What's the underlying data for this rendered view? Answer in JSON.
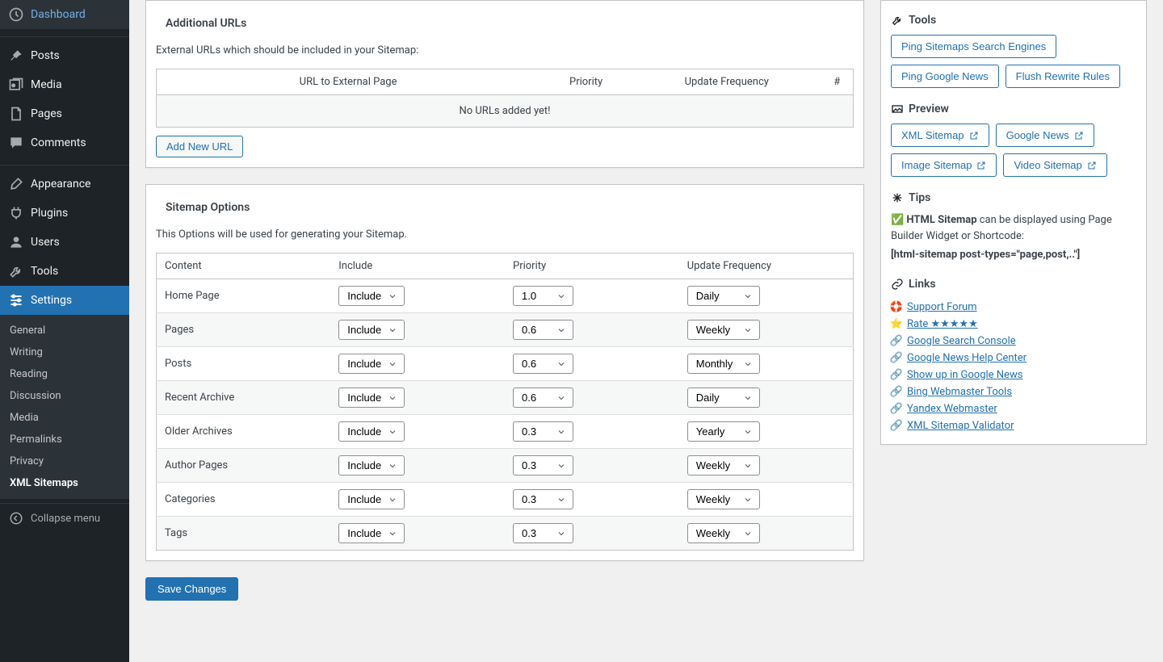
{
  "sidebar": {
    "dashboard": "Dashboard",
    "posts": "Posts",
    "media": "Media",
    "pages": "Pages",
    "comments": "Comments",
    "appearance": "Appearance",
    "plugins": "Plugins",
    "users": "Users",
    "tools": "Tools",
    "settings": "Settings",
    "collapse": "Collapse menu",
    "submenu": {
      "general": "General",
      "writing": "Writing",
      "reading": "Reading",
      "discussion": "Discussion",
      "media": "Media",
      "permalinks": "Permalinks",
      "privacy": "Privacy",
      "xml_sitemaps": "XML Sitemaps"
    }
  },
  "additional_urls": {
    "title": "Additional URLs",
    "description": "External URLs which should be included in your Sitemap:",
    "headers": {
      "url": "URL to External Page",
      "priority": "Priority",
      "freq": "Update Frequency",
      "hash": "#"
    },
    "empty": "No URLs added yet!",
    "add_button": "Add New URL"
  },
  "options": {
    "title": "Sitemap Options",
    "description": "This Options will be used for generating your Sitemap.",
    "headers": {
      "content": "Content",
      "include": "Include",
      "priority": "Priority",
      "freq": "Update Frequency"
    },
    "rows": [
      {
        "content": "Home Page",
        "include": "Include",
        "priority": "1.0",
        "freq": "Daily"
      },
      {
        "content": "Pages",
        "include": "Include",
        "priority": "0.6",
        "freq": "Weekly"
      },
      {
        "content": "Posts",
        "include": "Include",
        "priority": "0.6",
        "freq": "Monthly"
      },
      {
        "content": "Recent Archive",
        "include": "Include",
        "priority": "0.6",
        "freq": "Daily"
      },
      {
        "content": "Older Archives",
        "include": "Include",
        "priority": "0.3",
        "freq": "Yearly"
      },
      {
        "content": "Author Pages",
        "include": "Include",
        "priority": "0.3",
        "freq": "Weekly"
      },
      {
        "content": "Categories",
        "include": "Include",
        "priority": "0.3",
        "freq": "Weekly"
      },
      {
        "content": "Tags",
        "include": "Include",
        "priority": "0.3",
        "freq": "Weekly"
      }
    ]
  },
  "save_button": "Save Changes",
  "side": {
    "tools": {
      "title": "Tools",
      "ping_search": "Ping Sitemaps Search Engines",
      "ping_news": "Ping Google News",
      "flush": "Flush Rewrite Rules"
    },
    "preview": {
      "title": "Preview",
      "xml": "XML Sitemap",
      "gnews": "Google News",
      "image": "Image Sitemap",
      "video": "Video Sitemap"
    },
    "tips": {
      "title": "Tips",
      "check": "✅",
      "bold": "HTML Sitemap",
      "text": " can be displayed using Page Builder Widget or Shortcode:",
      "shortcode": "[html-sitemap post-types=\"page,post,..\"]"
    },
    "links": {
      "title": "Links",
      "support": {
        "icon": "🛟",
        "text": "Support Forum"
      },
      "rate": {
        "icon": "⭐",
        "text": "Rate ★★★★★"
      },
      "gsc": "Google Search Console",
      "gnhc": "Google News Help Center",
      "showup": "Show up in Google News",
      "bing": "Bing Webmaster Tools",
      "yandex": "Yandex Webmaster",
      "validator": "XML Sitemap Validator"
    }
  }
}
